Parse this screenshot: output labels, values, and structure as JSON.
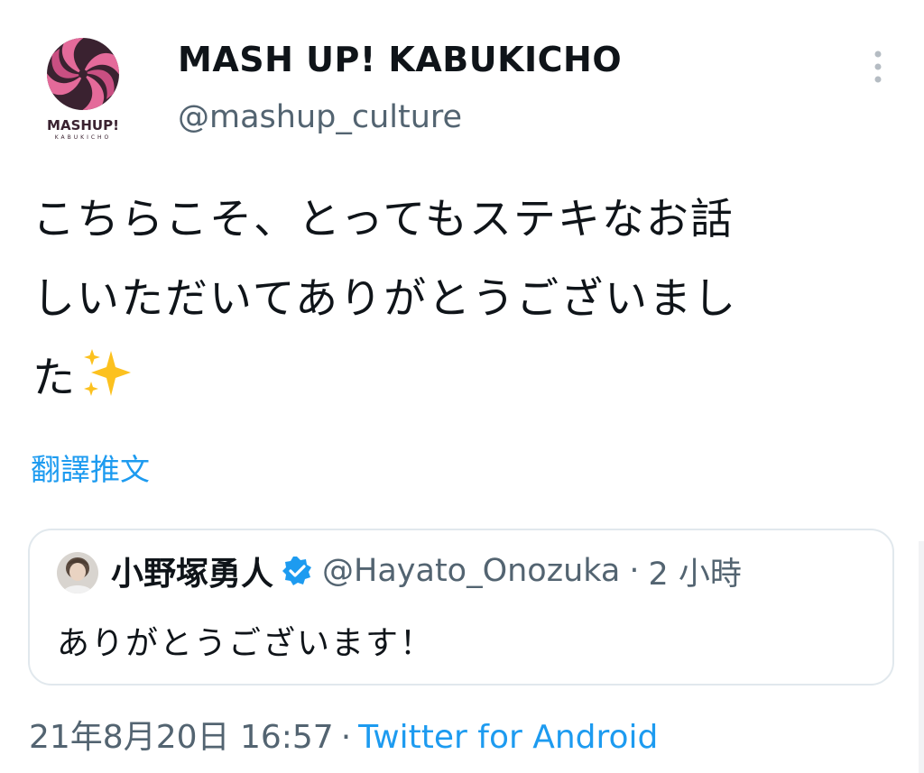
{
  "author": {
    "display_name": "MASH UP! KABUKICHO",
    "handle": "@mashup_culture",
    "avatar_wordmark": "MASHUP!",
    "avatar_subtext": "KABUKICHO"
  },
  "more_menu": {
    "icon": "vertical-ellipsis-icon"
  },
  "tweet": {
    "lines": [
      "こちらこそ、とってもステキなお話",
      "しいただいてありがとうございまし",
      "た"
    ],
    "emoji": "sparkles-icon"
  },
  "translate_label": "翻譯推文",
  "quoted_tweet": {
    "display_name": "小野塚勇人",
    "verified": true,
    "handle": "@Hayato_Onozuka",
    "separator": "·",
    "time": "2 小時",
    "text": "ありがとうございます！"
  },
  "meta": {
    "date": "21年8月20日 16:57",
    "separator": "·",
    "source": "Twitter for Android"
  },
  "colors": {
    "accent": "#1d9bf0",
    "secondary_text": "#536471",
    "border": "#e1e8ed",
    "logo_pink": "#e46a9a",
    "logo_dark": "#3a2230"
  }
}
